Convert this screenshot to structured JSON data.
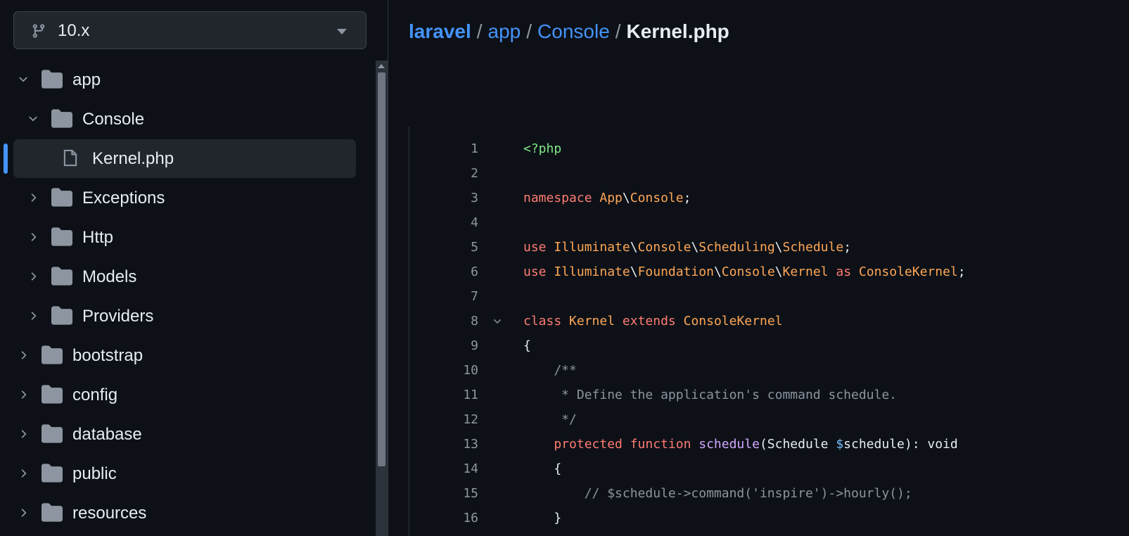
{
  "branch": {
    "label": "10.x"
  },
  "tree": [
    {
      "label": "app",
      "kind": "folder",
      "expanded": true,
      "depth": 0
    },
    {
      "label": "Console",
      "kind": "folder",
      "expanded": true,
      "depth": 1
    },
    {
      "label": "Kernel.php",
      "kind": "file",
      "active": true,
      "depth": 2
    },
    {
      "label": "Exceptions",
      "kind": "folder",
      "expanded": false,
      "depth": 1
    },
    {
      "label": "Http",
      "kind": "folder",
      "expanded": false,
      "depth": 1
    },
    {
      "label": "Models",
      "kind": "folder",
      "expanded": false,
      "depth": 1
    },
    {
      "label": "Providers",
      "kind": "folder",
      "expanded": false,
      "depth": 1
    },
    {
      "label": "bootstrap",
      "kind": "folder",
      "expanded": false,
      "depth": 0
    },
    {
      "label": "config",
      "kind": "folder",
      "expanded": false,
      "depth": 0
    },
    {
      "label": "database",
      "kind": "folder",
      "expanded": false,
      "depth": 0
    },
    {
      "label": "public",
      "kind": "folder",
      "expanded": false,
      "depth": 0
    },
    {
      "label": "resources",
      "kind": "folder",
      "expanded": false,
      "depth": 0
    }
  ],
  "breadcrumb": {
    "root": "laravel",
    "items": [
      "app",
      "Console"
    ],
    "current": "Kernel.php",
    "separator": "/"
  },
  "code": {
    "lines": [
      {
        "n": "1",
        "tokens": [
          [
            "g",
            "<?php"
          ]
        ]
      },
      {
        "n": "2",
        "tokens": []
      },
      {
        "n": "3",
        "tokens": [
          [
            "k",
            "namespace "
          ],
          [
            "t",
            "App"
          ],
          [
            "p",
            "\\"
          ],
          [
            "t",
            "Console"
          ],
          [
            "p",
            ";"
          ]
        ]
      },
      {
        "n": "4",
        "tokens": []
      },
      {
        "n": "5",
        "tokens": [
          [
            "k",
            "use "
          ],
          [
            "t",
            "Illuminate"
          ],
          [
            "p",
            "\\"
          ],
          [
            "t",
            "Console"
          ],
          [
            "p",
            "\\"
          ],
          [
            "t",
            "Scheduling"
          ],
          [
            "p",
            "\\"
          ],
          [
            "t",
            "Schedule"
          ],
          [
            "p",
            ";"
          ]
        ]
      },
      {
        "n": "6",
        "tokens": [
          [
            "k",
            "use "
          ],
          [
            "t",
            "Illuminate"
          ],
          [
            "p",
            "\\"
          ],
          [
            "t",
            "Foundation"
          ],
          [
            "p",
            "\\"
          ],
          [
            "t",
            "Console"
          ],
          [
            "p",
            "\\"
          ],
          [
            "t",
            "Kernel"
          ],
          [
            "k",
            " as "
          ],
          [
            "t",
            "ConsoleKernel"
          ],
          [
            "p",
            ";"
          ]
        ]
      },
      {
        "n": "7",
        "tokens": []
      },
      {
        "n": "8",
        "fold": true,
        "tokens": [
          [
            "k",
            "class "
          ],
          [
            "t",
            "Kernel"
          ],
          [
            "k",
            " extends "
          ],
          [
            "t",
            "ConsoleKernel"
          ]
        ]
      },
      {
        "n": "9",
        "tokens": [
          [
            "p",
            "{"
          ]
        ]
      },
      {
        "n": "10",
        "tokens": [
          [
            "c",
            "    /**"
          ]
        ]
      },
      {
        "n": "11",
        "tokens": [
          [
            "c",
            "     * Define the application's command schedule."
          ]
        ]
      },
      {
        "n": "12",
        "tokens": [
          [
            "c",
            "     */"
          ]
        ]
      },
      {
        "n": "13",
        "tokens": [
          [
            "k",
            "    protected function "
          ],
          [
            "f",
            "schedule"
          ],
          [
            "p",
            "(Schedule "
          ],
          [
            "v",
            "$"
          ],
          [
            "p",
            "schedule): void"
          ]
        ]
      },
      {
        "n": "14",
        "tokens": [
          [
            "p",
            "    {"
          ]
        ]
      },
      {
        "n": "15",
        "tokens": [
          [
            "c",
            "        // $schedule->command('inspire')->hourly();"
          ]
        ]
      },
      {
        "n": "16",
        "tokens": [
          [
            "p",
            "    }"
          ]
        ]
      }
    ]
  }
}
